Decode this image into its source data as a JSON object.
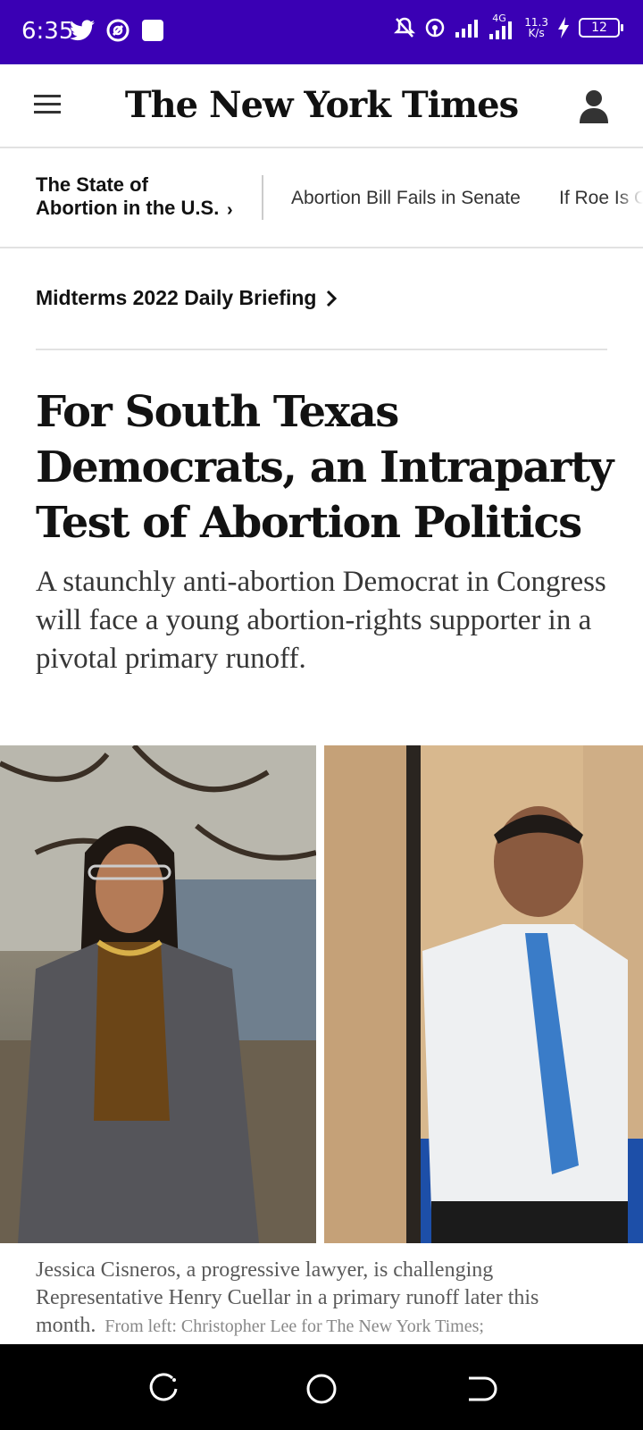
{
  "status_bar": {
    "time": "6:35",
    "net_speed_value": "11.3",
    "net_speed_unit": "K/s",
    "network_type": "4G",
    "battery": "12",
    "bg_color": "#3a00b4"
  },
  "header": {
    "logo": "The New York Times"
  },
  "section_strip": {
    "title": "The State of Abortion in the U.S.",
    "links": [
      "Abortion Bill Fails in Senate",
      "If Roe Is Overturned"
    ]
  },
  "briefing": {
    "label": "Midterms 2022 Daily Briefing"
  },
  "article": {
    "headline": "For South Texas Democrats, an Intraparty Test of Abortion Politics",
    "summary": "A staunchly anti-abortion Democrat in Congress will face a young abortion-rights supporter in a pivotal primary runoff.",
    "caption": "Jessica Cisneros, a progressive lawyer, is challenging Representative Henry Cuellar in a primary runoff later this month.",
    "credit": "From left: Christopher Lee for The New York Times;"
  },
  "icons": {
    "menu": "hamburger-icon",
    "account": "person-icon",
    "chevron": "chevron-right-icon"
  }
}
